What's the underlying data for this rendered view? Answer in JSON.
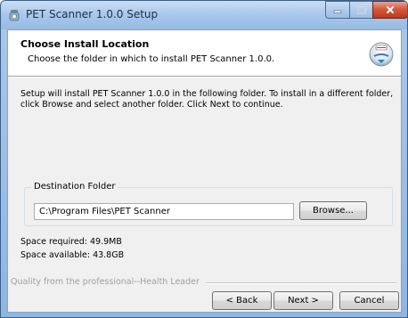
{
  "window": {
    "title": "PET Scanner 1.0.0 Setup",
    "icon": "installer-app-icon",
    "controls": {
      "minimize_icon": "minimize-icon",
      "maximize_icon": "maximize-icon",
      "close_icon": "close-icon"
    }
  },
  "header": {
    "title": "Choose Install Location",
    "subtitle": "Choose the folder in which to install PET Scanner 1.0.0.",
    "icon": "pet-scanner-logo-icon"
  },
  "body": {
    "intro": "Setup will install PET Scanner 1.0.0 in the following folder. To install in a different folder, click Browse and select another folder. Click Next to continue.",
    "destination": {
      "label": "Destination Folder",
      "value": "C:\\Program Files\\PET Scanner",
      "browse_label": "Browse..."
    },
    "space_required": "Space required: 49.9MB",
    "space_available": "Space available: 43.8GB"
  },
  "footer": {
    "branding": "Quality from the professional--Health Leader",
    "back_label": "< Back",
    "next_label": "Next >",
    "cancel_label": "Cancel"
  },
  "colors": {
    "title_bar": "#a8c7ea",
    "close_button": "#c0391b",
    "dialog_background": "#f0f0f0",
    "header_background": "#ffffff",
    "branding_text": "#a0a0a0"
  }
}
